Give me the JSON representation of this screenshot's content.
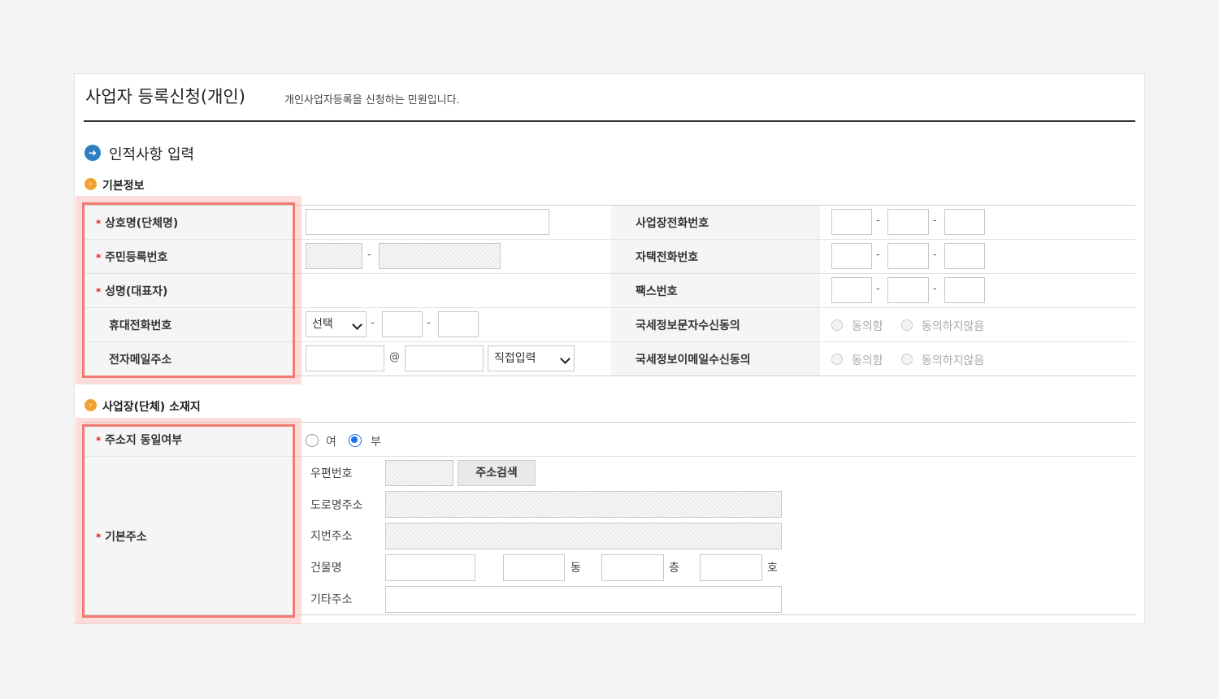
{
  "header": {
    "title": "사업자 등록신청(개인)",
    "subtitle": "개인사업자등록을 신청하는 민원입니다."
  },
  "section1": {
    "title": "인적사항 입력",
    "icon": "arrow-right-circle-icon",
    "basic_info": {
      "title": "기본정보",
      "icon": "chevron-circle-icon",
      "left_rows": [
        {
          "label": "상호명(단체명)",
          "required": true
        },
        {
          "label": "주민등록번호",
          "required": true
        },
        {
          "label": "성명(대표자)",
          "required": true
        },
        {
          "label": "휴대전화번호",
          "required": false
        },
        {
          "label": "전자메일주소",
          "required": false
        }
      ],
      "right_rows": [
        {
          "label": "사업장전화번호"
        },
        {
          "label": "자택전화번호"
        },
        {
          "label": "팩스번호"
        },
        {
          "label": "국세정보문자수신동의"
        },
        {
          "label": "국세정보이메일수신동의"
        }
      ],
      "mobile_select": "선택",
      "email_at": "@",
      "email_domain_select": "직접입력",
      "phone_dash": "-",
      "consent_options": {
        "agree": "동의함",
        "disagree": "동의하지않음"
      }
    }
  },
  "section2": {
    "title": "사업장(단체) 소재지",
    "icon": "chevron-circle-icon",
    "same_address": {
      "label": "주소지 동일여부",
      "required": true,
      "options": {
        "yes": "여",
        "no": "부"
      },
      "selected": "부"
    },
    "basic_address": {
      "label": "기본주소",
      "required": true,
      "postal_code_label": "우편번호",
      "search_button": "주소검색",
      "road_address_label": "도로명주소",
      "lot_address_label": "지번주소",
      "building_label": "건물명",
      "dong_suffix": "동",
      "floor_suffix": "층",
      "ho_suffix": "호",
      "other_address_label": "기타주소"
    }
  },
  "required_mark": "*",
  "colors": {
    "highlight": "#f07b70",
    "required": "#d0262d",
    "section_icon": "#2e7fc2",
    "sub_icon": "#f2a12e"
  }
}
